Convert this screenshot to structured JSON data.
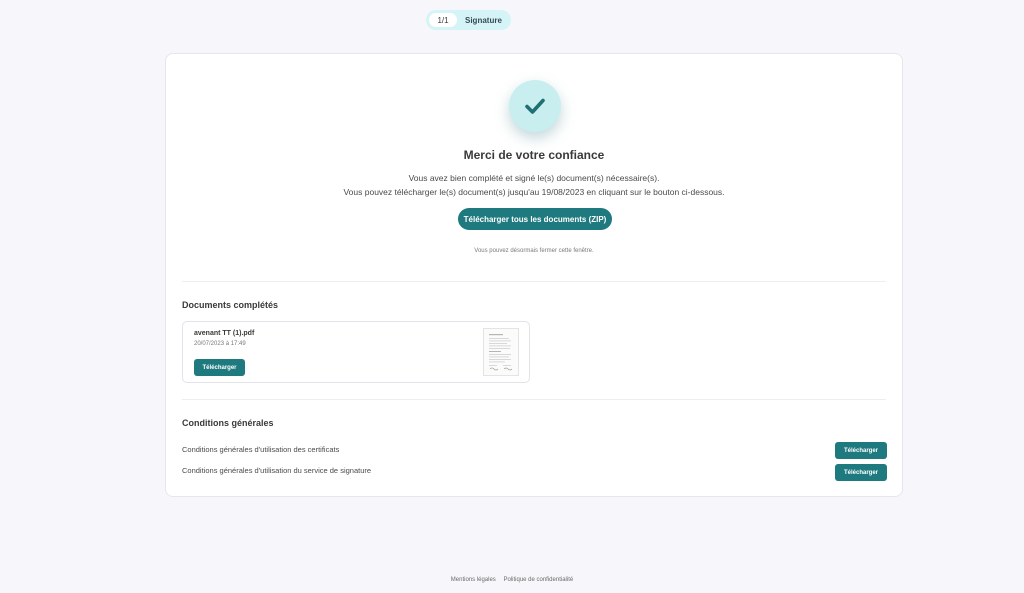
{
  "stepper": {
    "count": "1/1",
    "label": "Signature"
  },
  "confirmation": {
    "icon": "checkmark-icon",
    "title": "Merci de votre confiance",
    "message_line1": "Vous avez bien complété et signé le(s) document(s) nécessaire(s).",
    "message_line2": "Vous pouvez télécharger le(s) document(s) jusqu'au 19/08/2023 en cliquant sur le bouton ci-dessous.",
    "zip_button": "Télécharger tous les documents (ZIP)",
    "close_note": "Vous pouvez désormais fermer cette fenêtre."
  },
  "documents": {
    "title": "Documents complétés",
    "items": [
      {
        "name": "avenant TT (1).pdf",
        "date": "20/07/2023 à 17:49",
        "button": "Télécharger"
      }
    ]
  },
  "conditions": {
    "title": "Conditions générales",
    "items": [
      {
        "label": "Conditions générales d'utilisation des certificats",
        "button": "Télécharger"
      },
      {
        "label": "Conditions générales d'utilisation du service de signature",
        "button": "Télécharger"
      }
    ]
  },
  "footer": {
    "links": [
      "Mentions légales",
      "Politique de confidentialité"
    ]
  },
  "colors": {
    "accent": "#1f7a80",
    "check_bg": "#c9eef0",
    "stepper_bg": "#d4f4f8",
    "page_bg": "#f7f7fb"
  }
}
